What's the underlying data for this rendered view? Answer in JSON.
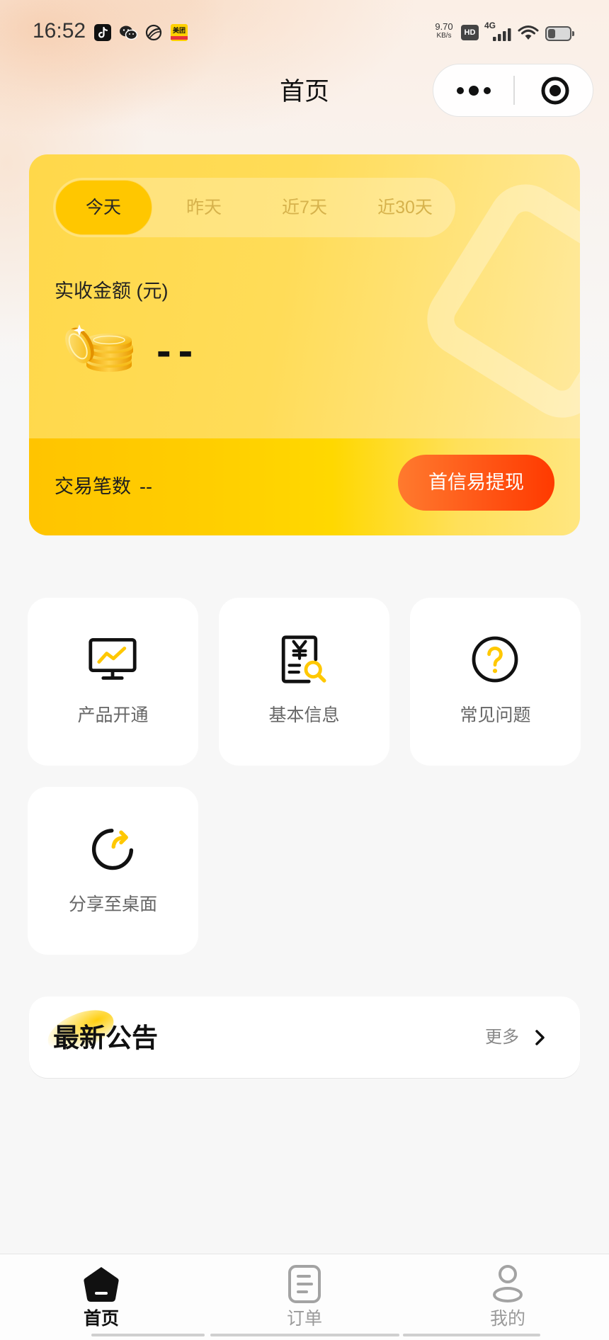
{
  "status_bar": {
    "time": "16:52",
    "left_icons": [
      "tiktok-icon",
      "wechat-icon",
      "ball-app-icon",
      "meituan-icon"
    ],
    "meituan_logo_text": "美团",
    "net_speed_value": "9.70",
    "net_speed_unit": "KB/s",
    "hd_badge": "HD",
    "network_type": "4G",
    "right_icons": [
      "signal-icon",
      "wifi-icon",
      "battery-icon"
    ],
    "battery_level": 0.35
  },
  "header": {
    "title": "首页",
    "capsule_icons": [
      "more-dots-icon",
      "target-close-icon"
    ]
  },
  "summary_card": {
    "tabs": [
      {
        "label": "今天",
        "active": true
      },
      {
        "label": "昨天",
        "active": false
      },
      {
        "label": "近7天",
        "active": false
      },
      {
        "label": "近30天",
        "active": false
      }
    ],
    "amount_label": "实收金额 (元)",
    "amount_icon": "gold-coins-icon",
    "amount_value": "--",
    "count_label": "交易笔数",
    "count_value": "--",
    "withdraw_button": "首信易提现"
  },
  "shortcuts": [
    {
      "label": "产品开通",
      "icon": "monitor-chart-icon"
    },
    {
      "label": "基本信息",
      "icon": "yuan-document-search-icon"
    },
    {
      "label": "常见问题",
      "icon": "question-circle-icon"
    },
    {
      "label": "分享至桌面",
      "icon": "share-arrow-icon"
    }
  ],
  "announcement": {
    "title": "最新公告",
    "more_label": "更多",
    "more_icon": "chevron-right-icon"
  },
  "tab_bar": {
    "items": [
      {
        "label": "首页",
        "icon": "home-icon",
        "active": true
      },
      {
        "label": "订单",
        "icon": "order-list-icon",
        "active": false
      },
      {
        "label": "我的",
        "icon": "profile-icon",
        "active": false
      }
    ]
  },
  "colors": {
    "page_background": "#F7F7F7",
    "card_yellow": "#FFD84A",
    "tab_active": "#FFC700",
    "tab_inactive_text": "#D6B24C",
    "withdraw_button_start": "#FF7A2E",
    "withdraw_button_end": "#FF3A00",
    "icon_accent": "#FFC800",
    "tab_bar_active": "#111111",
    "tab_bar_inactive": "#9A9A9A"
  }
}
